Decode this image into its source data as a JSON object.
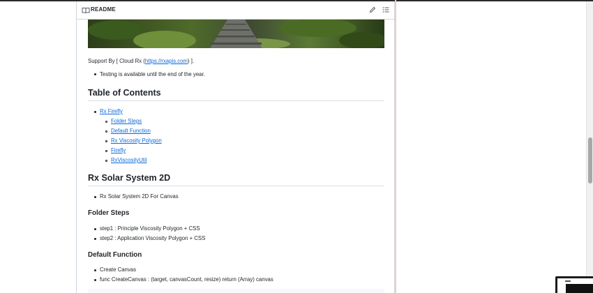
{
  "readme": {
    "header_title": "README",
    "support_prefix": "Support By [ Cloud Rx (",
    "support_link": "https://rxapis.com",
    "support_suffix": ") ].",
    "testing_note": "Testing is available until the end of the year."
  },
  "toc": {
    "heading": "Table of Contents",
    "top_item": "Rx Firefly",
    "sub_items": [
      "Folder Steps",
      "Default Function",
      "Rx Viscosity Polygon",
      "Firefly",
      "RxViscosityUtil"
    ]
  },
  "solar": {
    "heading": "Rx Solar System 2D",
    "item": "Rx Solar System 2D For Canvas"
  },
  "folder_steps": {
    "heading": "Folder Steps",
    "items": [
      "step1 : Principle Viscosity Polygon + CSS",
      "step2 : Application Viscosity Polygon + CSS"
    ]
  },
  "default_function": {
    "heading": "Default Function",
    "items": [
      "Create Canvas",
      "func CreateCanvas : (target, canvasCount, resize) return (Array) canvas"
    ]
  },
  "icons": {
    "header_left": "book-icon",
    "edit": "pencil-icon",
    "outline": "list-icon"
  },
  "colors": {
    "link": "#0969da",
    "text": "#1f2328",
    "border": "#d0d7de"
  }
}
